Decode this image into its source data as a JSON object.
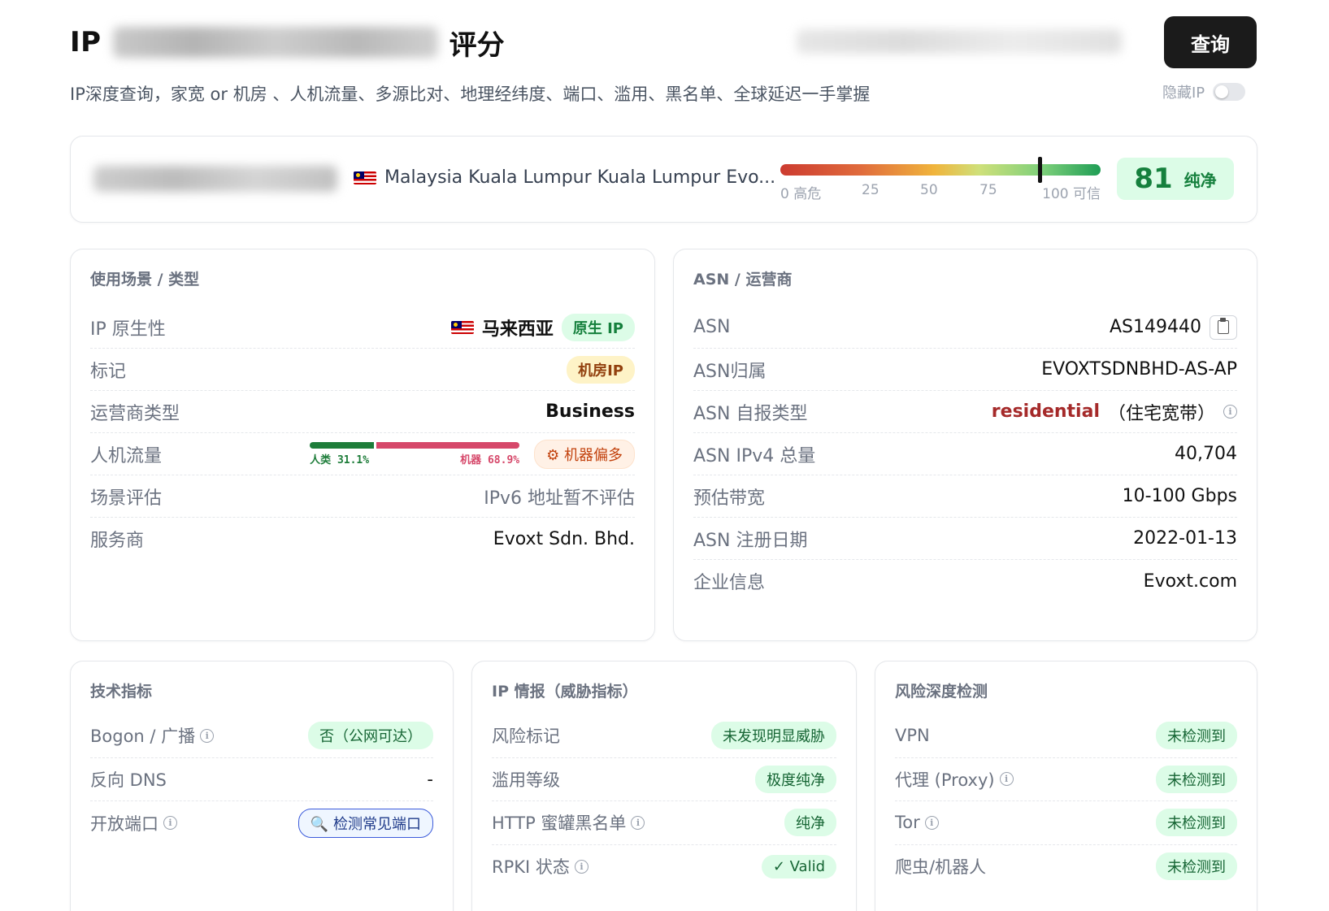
{
  "header": {
    "title_prefix": "IP",
    "title_suffix": "评分",
    "query_label": "查询",
    "subtitle": "IP深度查询，家宽 or 机房 、人机流量、多源比对、地理经纬度、端口、滥用、黑名单、全球延迟一手掌握",
    "hide_ip_label": "隐藏IP"
  },
  "summary": {
    "location": "Malaysia Kuala Lumpur Kuala Lumpur Evo...",
    "meter_ticks": [
      "0 高危",
      "25",
      "50",
      "75",
      "100 可信"
    ],
    "score": "81",
    "score_label": "纯净",
    "score_value": 81
  },
  "usage_card": {
    "title": "使用场景 / 类型",
    "native_label": "IP 原生性",
    "native_country": "马来西亚",
    "native_badge": "原生 IP",
    "mark_label": "标记",
    "mark_badge": "机房IP",
    "isp_type_label": "运营商类型",
    "isp_type_value": "Business",
    "traffic_label": "人机流量",
    "traffic_human": "人类 31.1%",
    "traffic_bot": "机器 68.9%",
    "traffic_human_pct": 31.1,
    "traffic_bot_pct": 68.9,
    "traffic_badge": "机器偏多",
    "scene_label": "场景评估",
    "scene_value": "IPv6 地址暂不评估",
    "provider_label": "服务商",
    "provider_value": "Evoxt Sdn. Bhd."
  },
  "asn_card": {
    "title": "ASN / 运营商",
    "asn_label": "ASN",
    "asn_value": "AS149440",
    "owner_label": "ASN归属",
    "owner_value": "EVOXTSDNBHD-AS-AP",
    "self_type_label": "ASN 自报类型",
    "self_type_value": "residential",
    "self_type_note": "（住宅宽带）",
    "ipv4_label": "ASN IPv4 总量",
    "ipv4_value": "40,704",
    "bandwidth_label": "预估带宽",
    "bandwidth_value": "10-100 Gbps",
    "reg_label": "ASN 注册日期",
    "reg_value": "2022-01-13",
    "company_label": "企业信息",
    "company_value": "Evoxt.com"
  },
  "tech_card": {
    "title": "技术指标",
    "bogon_label": "Bogon / 广播",
    "bogon_value": "否（公网可达）",
    "rdns_label": "反向 DNS",
    "rdns_value": "-",
    "ports_label": "开放端口",
    "ports_button": "检测常见端口"
  },
  "intel_card": {
    "title": "IP 情报（威胁指标）",
    "risk_label": "风险标记",
    "risk_value": "未发现明显威胁",
    "abuse_label": "滥用等级",
    "abuse_value": "极度纯净",
    "honeypot_label": "HTTP 蜜罐黑名单",
    "honeypot_value": "纯净",
    "rpki_label": "RPKI 状态",
    "rpki_value": "✓ Valid"
  },
  "risk_card": {
    "title": "风险深度检测",
    "vpn_label": "VPN",
    "vpn_value": "未检测到",
    "proxy_label": "代理 (Proxy)",
    "proxy_value": "未检测到",
    "tor_label": "Tor",
    "tor_value": "未检测到",
    "bot_label": "爬虫/机器人",
    "bot_value": "未检测到"
  }
}
